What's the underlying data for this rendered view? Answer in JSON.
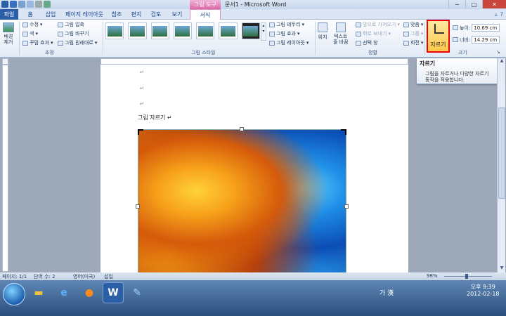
{
  "window": {
    "context_tab": "그림 도구",
    "title": "문서1 - Microsoft Word"
  },
  "tabs": [
    "파일",
    "홈",
    "삽입",
    "페이지 레이아웃",
    "참조",
    "편지",
    "검토",
    "보기",
    "서식"
  ],
  "ribbon": {
    "remove_bg": "배경\n제거",
    "adjust": {
      "corrections": "수정",
      "color": "색",
      "artistic": "꾸밈 효과",
      "compress": "그림 압축",
      "change": "그림 바꾸기",
      "reset": "그림 원래대로",
      "label": "조정"
    },
    "styles": {
      "border": "그림 테두리",
      "effects": "그림 효과",
      "layout": "그림 레이아웃",
      "label": "그림 스타일"
    },
    "arrange": {
      "position": "위치",
      "wrap": "텍스트\n줄 바꿈",
      "bring_forward": "앞으로 가져오기",
      "send_backward": "뒤로 보내기",
      "selection_pane": "선택 창",
      "align": "맞춤",
      "group": "그룹",
      "rotate": "회전",
      "label": "정렬"
    },
    "size": {
      "crop": "자르기",
      "height_label": "높이:",
      "height": "10.69 cm",
      "width_label": "너비:",
      "width": "14.29 cm",
      "label": "크기"
    }
  },
  "tooltip": {
    "title": "자르기",
    "desc1": "그림을 자르거나 다양한 자르기",
    "desc2": "동작을 적용합니다."
  },
  "document": {
    "para_mark": "↵",
    "heading": "그림 자르기 ↵"
  },
  "status": {
    "page": "페이지: 1/1",
    "words": "단어 수: 2",
    "lang": "영어(미국)",
    "mode": "삽입",
    "zoom": "98%"
  },
  "taskbar": {
    "tray_text": "가 漢",
    "time": "오후 9:39",
    "date": "2012-02-18"
  },
  "colors": {
    "accent_pink": "#d96aa8",
    "file_blue": "#2a5fa8",
    "highlight_red": "#e00000"
  }
}
